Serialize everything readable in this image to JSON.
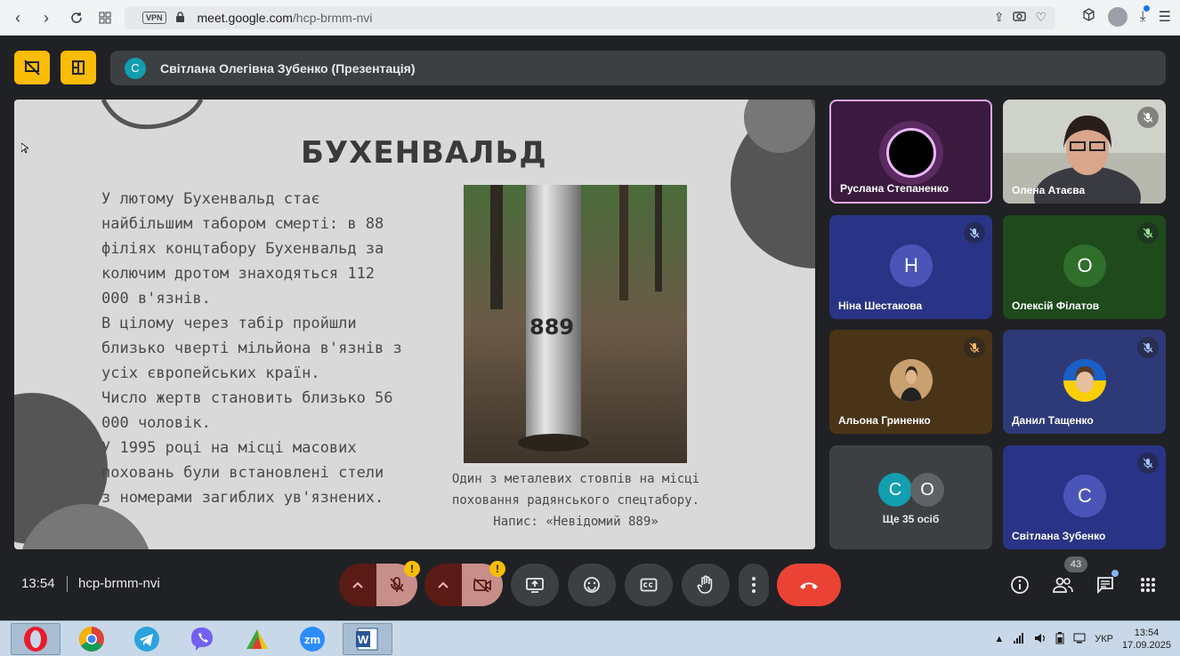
{
  "browser": {
    "vpn": "VPN",
    "url_domain": "meet.google.com",
    "url_path": "/hcp-brmm-nvi"
  },
  "presenter": {
    "initial": "С",
    "name": "Світлана Олегівна Зубенко (Презентація)"
  },
  "slide": {
    "title": "БУХЕНВАЛЬД",
    "text": "У лютому Бухенвальд стає\nнайбільшим табором смерті: в 88\nфіліях концтабору Бухенвальд за\nколючим дротом знаходяться 112\n000 в'язнів.\nВ цілому через табір пройшли\nблизько чверті мільйона в'язнів з\nусіх європейських країн.\nЧисло жертв становить близько 56\n000 чоловік.\nУ 1995 році на місці масових\nпоховань були встановлені стели\nз номерами загиблих ув'язнених.",
    "photo_number": "889",
    "caption": "Один з металевих стовпів на місці\nпоховання радянського спецтабору.\nНапис: «Невідомий 889»"
  },
  "participants": [
    {
      "name": "Руслана Степаненко"
    },
    {
      "name": "Олена Атаєва"
    },
    {
      "name": "Ніна Шестакова",
      "initial": "Н"
    },
    {
      "name": "Олексій Філатов",
      "initial": "О"
    },
    {
      "name": "Альона Гриненко"
    },
    {
      "name": "Данил Тащенко"
    },
    {
      "name": "Ще 35 осіб",
      "initials": [
        "С",
        "О"
      ]
    },
    {
      "name": "Світлана Зубенко",
      "initial": "С"
    }
  ],
  "bottom": {
    "time": "13:54",
    "meeting_code": "hcp-brmm-nvi",
    "warn": "!",
    "people_count": "43"
  },
  "taskbar": {
    "lang": "УКР",
    "time": "13:54",
    "date": "17.09.2025"
  },
  "colors": {
    "accent_yellow": "#fbbc04",
    "end_call": "#ea4335",
    "tile_blue": "#2b3a8c",
    "tile_green": "#1f4a1f"
  }
}
